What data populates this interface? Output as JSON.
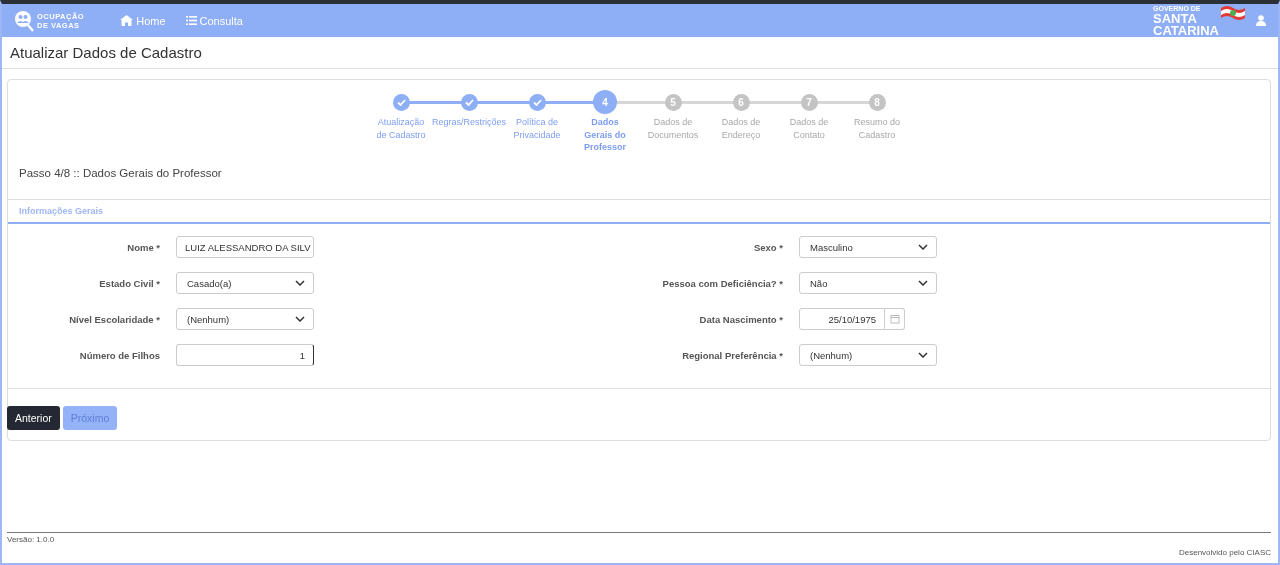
{
  "nav": {
    "logo_lines": [
      "OCUPAÇÃO",
      "DE VAGAS"
    ],
    "links": [
      {
        "label": "Home"
      },
      {
        "label": "Consulta"
      }
    ],
    "gov_logo": {
      "top": "GOVERNO DE",
      "lines": [
        "SANTA",
        "CATARINA"
      ]
    }
  },
  "page_title": "Atualizar Dados de Cadastro",
  "steps": [
    {
      "label": "Atualização de Cadastro",
      "completed": true,
      "selected": false
    },
    {
      "label": "Regras/Restrições",
      "completed": true,
      "selected": false
    },
    {
      "label": "Política de Privacidade",
      "completed": true,
      "selected": false
    },
    {
      "number": "4",
      "label": "Dados Gerais do Professor",
      "completed": false,
      "selected": true
    },
    {
      "number": "5",
      "label": "Dados de Documentos",
      "completed": false,
      "selected": false
    },
    {
      "number": "6",
      "label": "Dados de Endereço",
      "completed": false,
      "selected": false
    },
    {
      "number": "7",
      "label": "Dados de Contato",
      "completed": false,
      "selected": false
    },
    {
      "number": "8",
      "label": "Resumo do Cadastro",
      "completed": false,
      "selected": false
    }
  ],
  "step_caption": "Passo 4/8 :: Dados Gerais do Professor",
  "section_title": "Informações Gerais",
  "fields_left": [
    {
      "label": "Nome *",
      "kind": "text",
      "value": "LUIZ ALESSANDRO DA SILV"
    },
    {
      "label": "Estado Civil *",
      "kind": "select",
      "value": "Casado(a)"
    },
    {
      "label": "Nível Escolaridade *",
      "kind": "select",
      "value": "(Nenhum)"
    },
    {
      "label": "Número de Filhos",
      "kind": "number",
      "value": "1"
    }
  ],
  "fields_right": [
    {
      "label": "Sexo *",
      "kind": "select",
      "value": "Masculino"
    },
    {
      "label": "Pessoa com Deficiência? *",
      "kind": "select",
      "value": "Não"
    },
    {
      "label": "Data Nascimento *",
      "kind": "date",
      "value": "25/10/1975"
    },
    {
      "label": "Regional Preferência *",
      "kind": "select",
      "value": "(Nenhum)"
    }
  ],
  "buttons": [
    {
      "label": "Anterior",
      "kind": "dark"
    },
    {
      "label": "Próximo",
      "kind": "light"
    }
  ],
  "footer": {
    "version": "Versão: 1.0.0",
    "credit": "Desenvolvido pelo CIASC"
  }
}
